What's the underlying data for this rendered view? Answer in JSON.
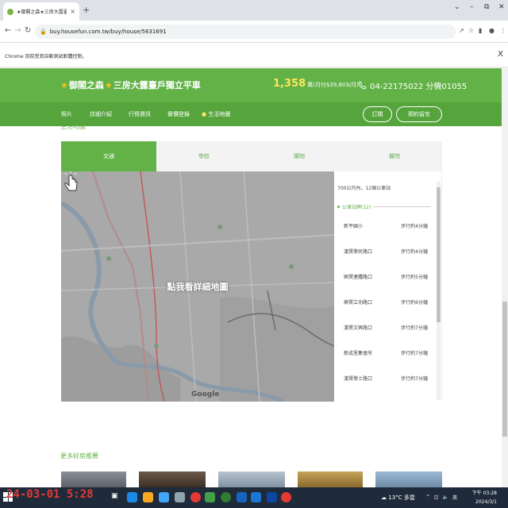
{
  "browser": {
    "tab_title": "★御閣之森★三房大露臺戶獨立",
    "tab_close": "×",
    "new_tab": "+",
    "url": "buy.housefun.com.tw/buy/house/5631691",
    "window_controls": [
      "⌄",
      "–",
      "⧉",
      "✕"
    ]
  },
  "infobar": {
    "message": "Chrome 目前受到自動測試軟體控制。",
    "close": "X"
  },
  "header": {
    "title_part1": "御閣之森",
    "title_part2": "三房大露臺戶獨立平車",
    "price": "1,358",
    "price_unit": "萬(月付$39,803/月)",
    "phone": "04-22175022 分機01055"
  },
  "subnav": {
    "items": [
      "照片",
      "詳細介紹",
      "行情資訊",
      "實價登錄",
      "生活地圖"
    ],
    "subscribe": "訂閱",
    "book": "預約留言"
  },
  "section": {
    "title": "生活地圖",
    "tabs": [
      "交通",
      "學校",
      "購物",
      "醫院"
    ]
  },
  "map": {
    "cta": "點我看詳細地圖",
    "google": "Google"
  },
  "panel": {
    "summary": "700公尺內，12個公車站",
    "group_label": "公車站牌(12)",
    "stops": [
      {
        "name": "新平國小",
        "walk": "步行約4分鐘"
      },
      {
        "name": "漢賢學民路口",
        "walk": "步行約4分鐘"
      },
      {
        "name": "興賢連體路口",
        "walk": "步行約5分鐘"
      },
      {
        "name": "興賢立功路口",
        "walk": "步行約6分鐘"
      },
      {
        "name": "漢賢文興路口",
        "walk": "步行約7分鐘"
      },
      {
        "name": "新成里集會所",
        "walk": "步行約7分鐘"
      },
      {
        "name": "漢賢學士路口",
        "walk": "步行約7分鐘"
      }
    ]
  },
  "more": {
    "title": "更多好房推薦"
  },
  "taskbar": {
    "overlay_date": "24-03-01 5:28",
    "weather": "13°C 多雲",
    "tray": "英",
    "time": "下午 03:28",
    "date": "2024/3/1"
  },
  "colors": {
    "brand_green": "#62b247",
    "price_yellow": "#ffe45c",
    "taskbar": "#1f2a3a",
    "overlay_red": "#e53935"
  }
}
